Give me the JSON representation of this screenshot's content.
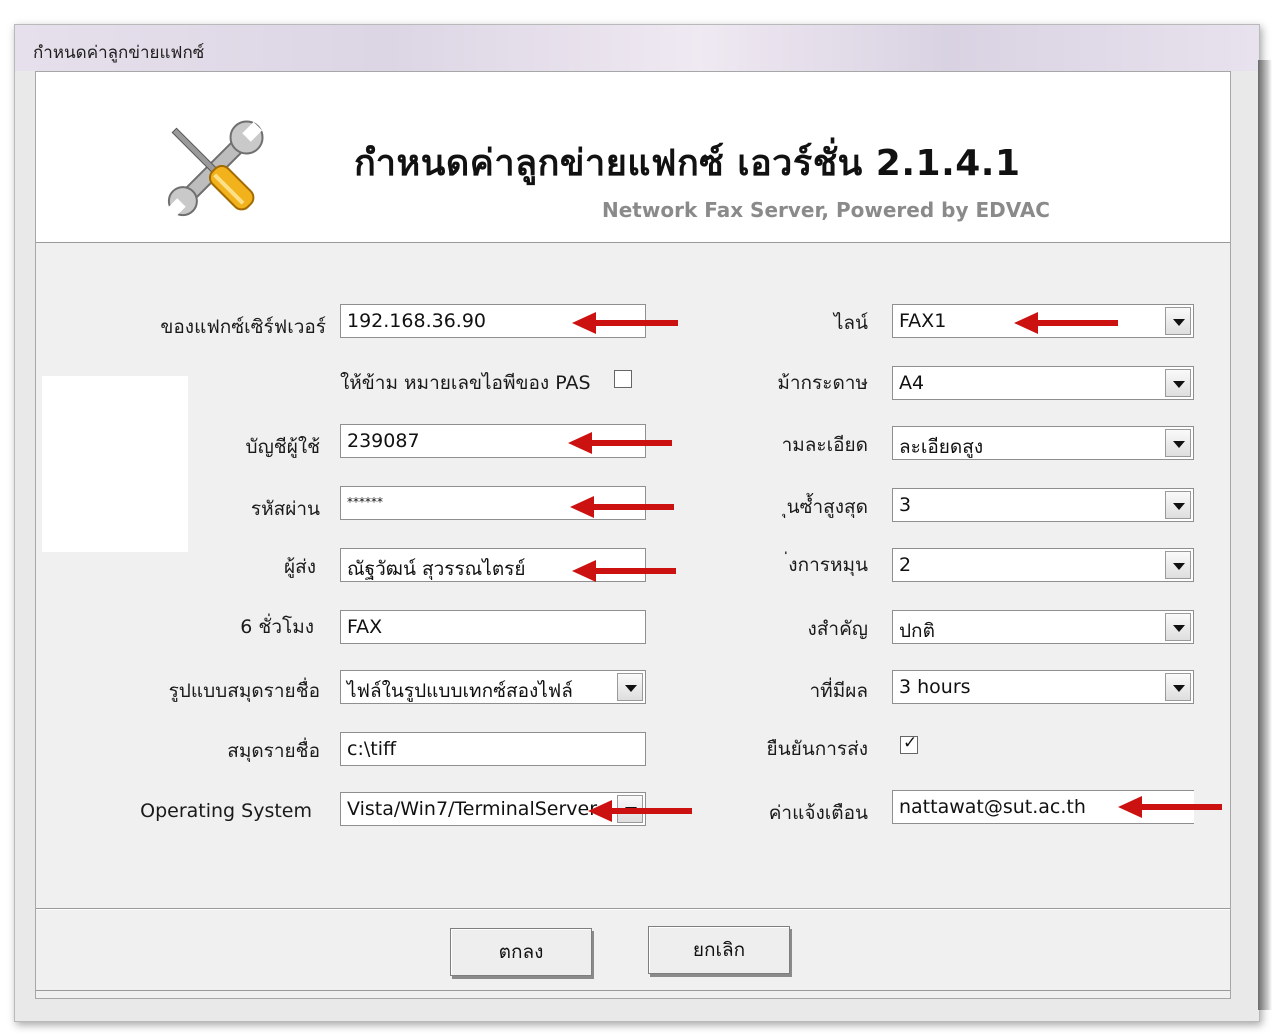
{
  "window": {
    "title": "กำหนดค่าลูกข่ายแฟกซ์"
  },
  "header": {
    "title": "กำหนดค่าลูกข่ายแฟกซ์ เอวร์ชั่น 2.1.4.1",
    "subtitle": "Network Fax Server, Powered by EDVAC",
    "icon": "tools-icon"
  },
  "left": {
    "server_label": "ของแฟกซ์เซิร์ฟเวอร์",
    "server_value": "192.168.36.90",
    "skip_check_label": "ให้ข้าม หมายเลขไอพีของ PAS",
    "skip_checked": false,
    "account_label": "บัญชีผู้ใช้",
    "account_value": "239087",
    "password_label": "รหัสผ่าน",
    "password_value": "******",
    "sender_label": "ผู้ส่ง",
    "sender_value": "ณัฐวัฒน์ สุวรรณไตรย์",
    "hours_label": "6 ชั่วโมง",
    "hours_value": "FAX",
    "format_label": "รูปแบบสมุดรายชื่อ",
    "format_value": "ไฟล์ในรูปแบบเทกซ์สองไฟล์",
    "book_label": "สมุดรายชื่อ",
    "book_value": "c:\\tiff",
    "os_label": "Operating System",
    "os_value": "Vista/Win7/TerminalServer"
  },
  "right": {
    "line_label": "ไลน์",
    "line_value": "FAX1",
    "paper_label": "ม้ากระดาษ",
    "paper_value": "A4",
    "resolution_label": "ามละเอียด",
    "resolution_value": "ละเอียดสูง",
    "retry_label": "ุนซ้ำสูงสุด",
    "retry_value": "3",
    "rotate_label": "่งการหมุน",
    "rotate_value": "2",
    "priority_label": "งสำคัญ",
    "priority_value": "ปกติ",
    "effect_label": "าที่มีผล",
    "effect_value": "3 hours",
    "confirm_label": "ยืนยันการส่ง",
    "confirm_checked": true,
    "notify_label": "ค่าแจ้งเตือน",
    "notify_value": "nattawat@sut.ac.th"
  },
  "buttons": {
    "ok": "ตกลง",
    "cancel": "ยกเลิก"
  },
  "colors": {
    "arrow": "#cc1111",
    "title_bar": "#e6e0ec"
  }
}
